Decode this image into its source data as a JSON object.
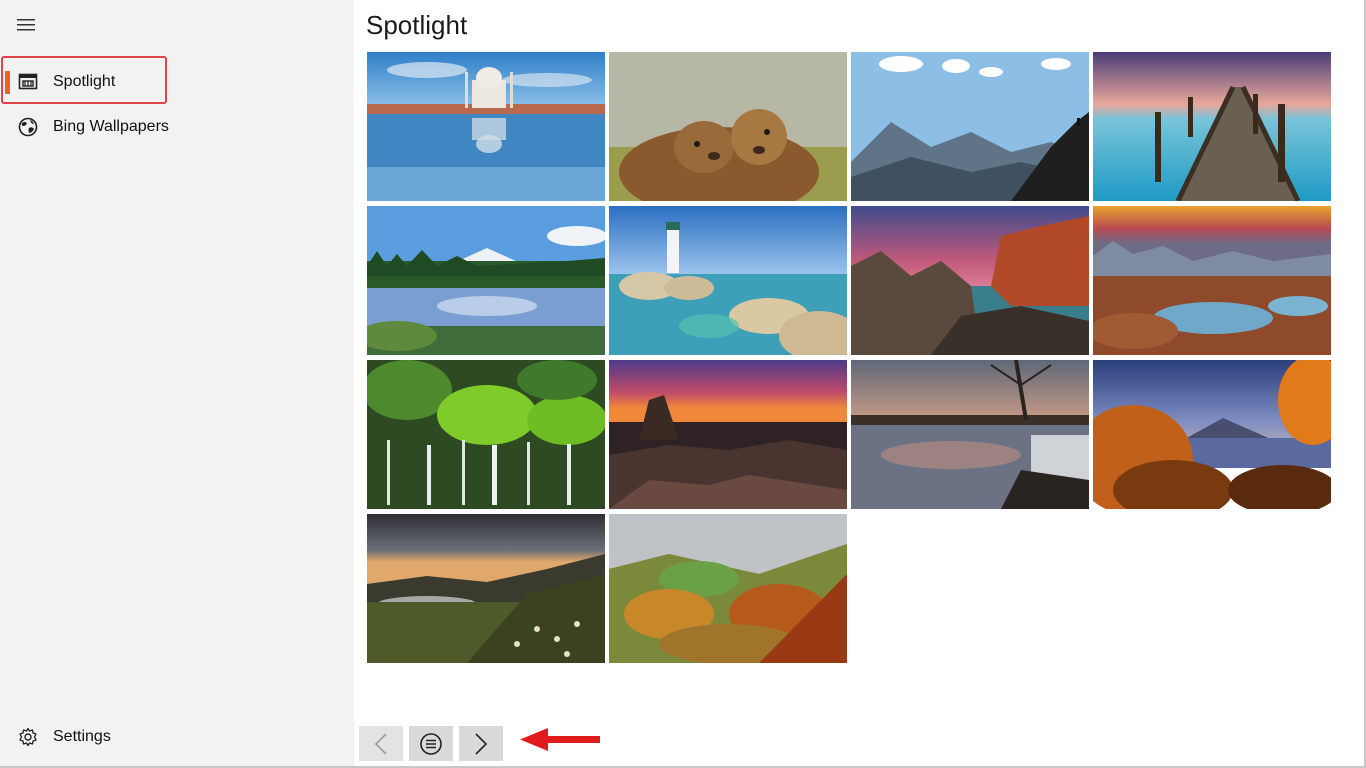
{
  "sidebar": {
    "menu_icon": "hamburger-icon",
    "items": [
      {
        "label": "Spotlight",
        "icon": "spotlight-icon",
        "selected": true
      },
      {
        "label": "Bing Wallpapers",
        "icon": "globe-icon",
        "selected": false
      }
    ],
    "settings": {
      "label": "Settings",
      "icon": "gear-icon"
    }
  },
  "main": {
    "title": "Spotlight",
    "thumbnails": [
      {
        "icon": "taj-mahal-thumbnail"
      },
      {
        "icon": "marmots-thumbnail"
      },
      {
        "icon": "mountain-climber-thumbnail"
      },
      {
        "icon": "wooden-pier-thumbnail"
      },
      {
        "icon": "forest-lake-mountain-thumbnail"
      },
      {
        "icon": "lighthouse-rocks-thumbnail"
      },
      {
        "icon": "red-cliffs-sea-thumbnail"
      },
      {
        "icon": "crater-lake-sunset-thumbnail"
      },
      {
        "icon": "mossy-waterfall-thumbnail"
      },
      {
        "icon": "temple-ruins-sunset-thumbnail"
      },
      {
        "icon": "river-waterfall-dusk-thumbnail"
      },
      {
        "icon": "autumn-mountain-fuji-thumbnail"
      },
      {
        "icon": "sunset-valley-flowers-thumbnail"
      },
      {
        "icon": "autumn-valley-thumbnail"
      }
    ]
  },
  "pager": {
    "prev_icon": "chevron-left-icon",
    "list_icon": "list-circle-icon",
    "next_icon": "chevron-right-icon"
  },
  "annotation": {
    "icon": "red-arrow-icon",
    "color": "#e01b1b"
  },
  "colors": {
    "accent": "#e8651a",
    "highlight_border": "#e0454a",
    "sidebar_bg": "#f2f2f2"
  }
}
